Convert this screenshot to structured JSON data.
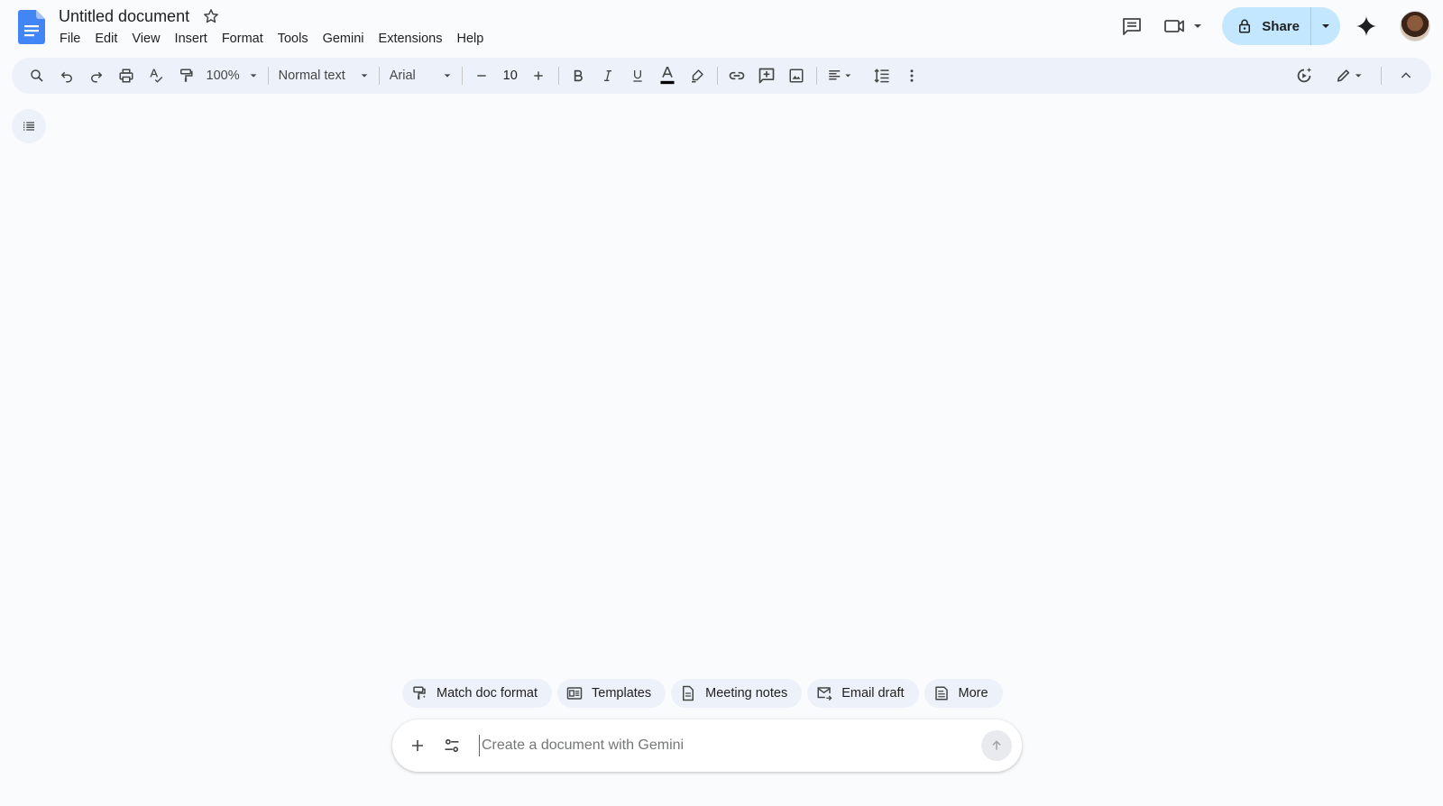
{
  "header": {
    "title": "Untitled document",
    "menu": [
      "File",
      "Edit",
      "View",
      "Insert",
      "Format",
      "Tools",
      "Gemini",
      "Extensions",
      "Help"
    ],
    "share_label": "Share"
  },
  "toolbar": {
    "zoom": "100%",
    "style": "Normal text",
    "font": "Arial",
    "font_size": "10"
  },
  "chips": [
    {
      "label": "Match doc format",
      "icon": "match-format-icon"
    },
    {
      "label": "Templates",
      "icon": "templates-icon"
    },
    {
      "label": "Meeting notes",
      "icon": "document-icon"
    },
    {
      "label": "Email draft",
      "icon": "email-icon"
    },
    {
      "label": "More",
      "icon": "more-doc-icon"
    }
  ],
  "prompt": {
    "placeholder": "Create a document with Gemini"
  },
  "colors": {
    "brand_blue": "#4285f4",
    "share_bg": "#c2e7ff",
    "toolbar_bg": "#edf2fa",
    "page_bg": "#f9fbfd"
  }
}
